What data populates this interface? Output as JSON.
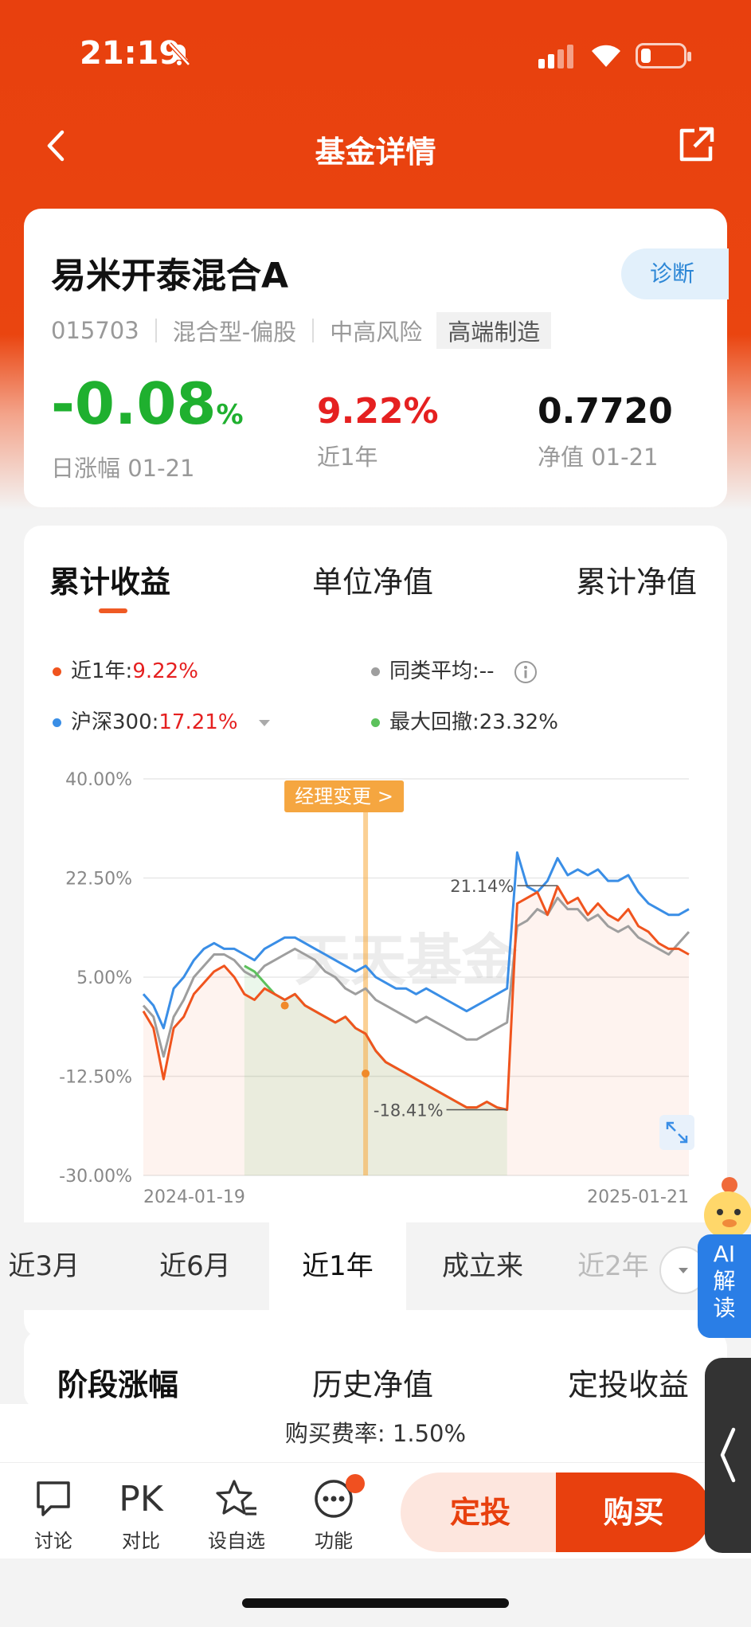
{
  "status_bar": {
    "time": "21:19"
  },
  "nav": {
    "title": "基金详情"
  },
  "fund": {
    "name": "易米开泰混合A",
    "diagnose_label": "诊断",
    "code": "015703",
    "type": "混合型-偏股",
    "risk": "中高风险",
    "theme_tag": "高端制造",
    "daily_change_value": "-0.08",
    "daily_change_unit": "%",
    "daily_change_label": "日涨幅 01-21",
    "year_return": "9.22%",
    "year_return_label": "近1年",
    "nav_value": "0.7720",
    "nav_label": "净值 01-21"
  },
  "chart_tabs": [
    "累计收益",
    "单位净值",
    "累计净值"
  ],
  "legend": {
    "fund_label": "近1年:",
    "fund_value": "9.22%",
    "peer_label": "同类平均:",
    "peer_value": "--",
    "index_label": "沪深300:",
    "index_value": "17.21%",
    "drawdown_label": "最大回撤:",
    "drawdown_value": "23.32%"
  },
  "annotations": {
    "manager_change": "经理变更 >",
    "high_label": "21.14%",
    "low_label": "-18.41%",
    "watermark": "天天基金"
  },
  "colors": {
    "fund": "#f0541e",
    "peer": "#9e9e9e",
    "index": "#3a8ee6",
    "drawdown": "#5cc15c",
    "accent": "#e8400e"
  },
  "chart_data": {
    "type": "line",
    "ylim": [
      -30,
      40
    ],
    "y_ticks": [
      "40.00%",
      "22.50%",
      "5.00%",
      "-12.50%",
      "-30.00%"
    ],
    "y_tick_values": [
      40,
      22.5,
      5,
      -12.5,
      -30
    ],
    "x_start": "2024-01-19",
    "x_end": "2025-01-21",
    "series": [
      {
        "name": "近1年",
        "color": "#f0541e",
        "values": [
          -1,
          -4,
          -13,
          -4,
          -2,
          2,
          4,
          6,
          7,
          5,
          2,
          1,
          3,
          2,
          1,
          2,
          0,
          -1,
          -2,
          -3,
          -2,
          -4,
          -5,
          -8,
          -10,
          -11,
          -12,
          -13,
          -14,
          -15,
          -16,
          -17,
          -18,
          -18,
          -17,
          -18,
          -18.4,
          18,
          19,
          20,
          16,
          21,
          18,
          19,
          16,
          18,
          16,
          15,
          17,
          14,
          13,
          11,
          10,
          10,
          9
        ]
      },
      {
        "name": "同类平均",
        "color": "#9e9e9e",
        "values": [
          0,
          -2,
          -9,
          -2,
          1,
          5,
          7,
          9,
          9,
          8,
          6,
          5,
          7,
          8,
          9,
          10,
          9,
          8,
          6,
          5,
          3,
          2,
          3,
          1,
          0,
          -1,
          -2,
          -3,
          -2,
          -3,
          -4,
          -5,
          -6,
          -6,
          -5,
          -4,
          -3,
          14,
          15,
          17,
          16,
          19,
          17,
          17,
          15,
          16,
          14,
          13,
          14,
          12,
          11,
          10,
          9,
          11,
          13
        ]
      },
      {
        "name": "沪深300",
        "color": "#3a8ee6",
        "values": [
          2,
          0,
          -4,
          3,
          5,
          8,
          10,
          11,
          10,
          10,
          9,
          8,
          10,
          11,
          12,
          12,
          11,
          10,
          9,
          8,
          7,
          6,
          7,
          5,
          4,
          3,
          3,
          2,
          3,
          2,
          1,
          0,
          -1,
          0,
          1,
          2,
          3,
          27,
          21,
          20,
          22,
          26,
          23,
          24,
          23,
          24,
          22,
          22,
          23,
          20,
          18,
          17,
          16,
          16,
          17
        ]
      },
      {
        "name": "最大回撤",
        "color": "#5cc15c",
        "values": [
          null,
          null,
          null,
          null,
          null,
          null,
          null,
          null,
          null,
          null,
          7,
          6,
          4,
          2,
          1,
          2,
          0,
          -1,
          -2,
          -3,
          -2,
          -4,
          -5,
          -8,
          -10,
          -11,
          -12,
          -13,
          -14,
          -15,
          -16,
          -17,
          -18,
          -18,
          -17,
          -18,
          -18.4,
          null,
          null,
          null,
          null,
          null,
          null,
          null,
          null,
          null,
          null,
          null,
          null,
          null,
          null,
          null,
          null,
          null,
          null
        ]
      }
    ]
  },
  "periods": [
    "近3月",
    "近6月",
    "近1年",
    "成立来",
    "近2年"
  ],
  "stage_tabs": [
    "阶段涨幅",
    "历史净值",
    "定投收益"
  ],
  "fee": {
    "label": "购买费率:",
    "value": "1.50%"
  },
  "bottom_bar": {
    "discuss": "讨论",
    "pk_icon": "PK",
    "compare": "对比",
    "watchlist": "设自选",
    "functions": "功能",
    "dingtou": "定投",
    "buy": "购买"
  },
  "ai_widget": {
    "line1": "AI",
    "line2": "解",
    "line3": "读"
  }
}
